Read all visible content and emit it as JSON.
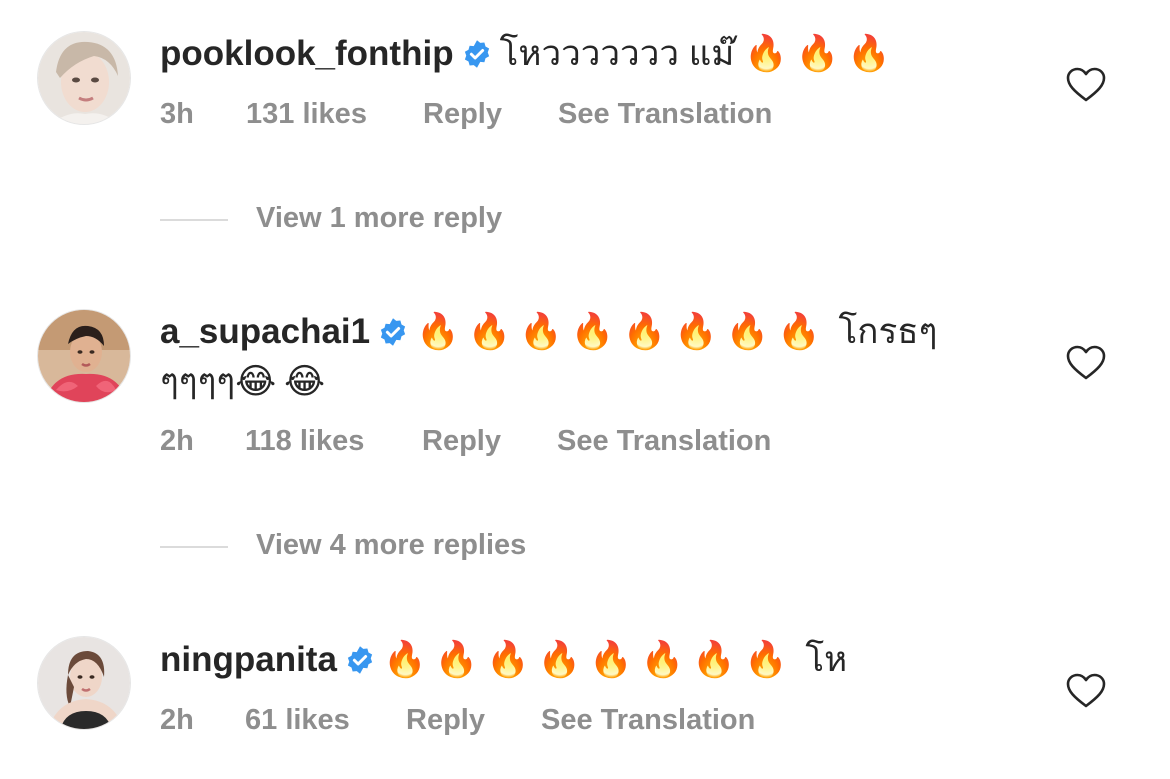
{
  "comments": [
    {
      "username": "pooklook_fonthip",
      "text": "โหววววววว แม๊",
      "emoji": "🔥🔥🔥",
      "time": "3h",
      "likes": "131 likes",
      "reply": "Reply",
      "translate": "See Translation",
      "view_more": "View 1 more reply",
      "avatar_icon": "avatar-photo"
    },
    {
      "username": "a_supachai1",
      "emoji": "🔥🔥🔥🔥🔥🔥🔥🔥",
      "text": "โกรธๆ",
      "text2": "ๆๆๆๆ",
      "emoji2": "😂😂",
      "time": "2h",
      "likes": "118 likes",
      "reply": "Reply",
      "translate": "See Translation",
      "view_more": "View 4 more replies",
      "avatar_icon": "avatar-photo"
    },
    {
      "username": "ningpanita",
      "emoji": "🔥🔥🔥🔥🔥🔥🔥🔥",
      "text": "โห",
      "time": "2h",
      "likes": "61 likes",
      "reply": "Reply",
      "translate": "See Translation",
      "avatar_icon": "avatar-photo"
    }
  ],
  "colors": {
    "text": "#262626",
    "meta": "#8e8e8e",
    "verified": "#3897f0",
    "divider": "#dbdbdb"
  },
  "icons": {
    "verified": "verified-badge-icon",
    "like": "heart-outline-icon"
  }
}
